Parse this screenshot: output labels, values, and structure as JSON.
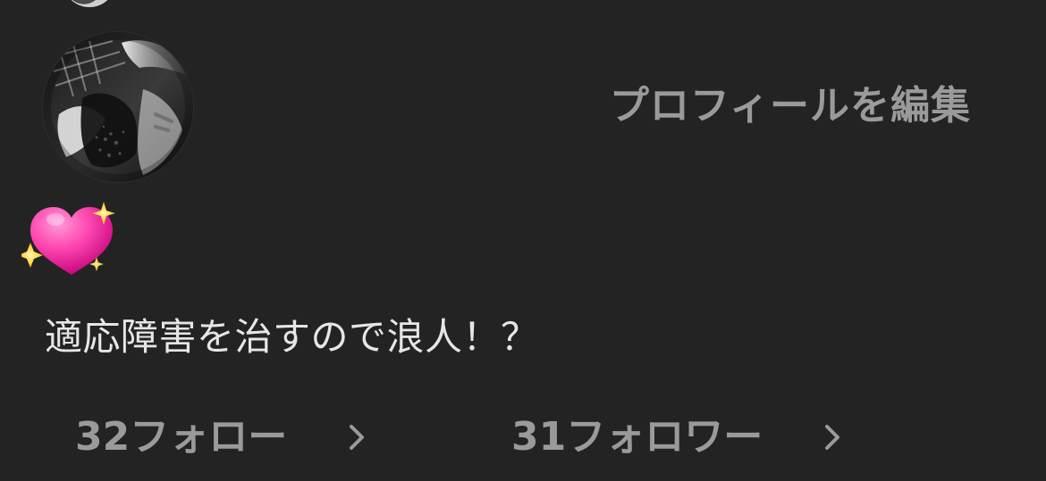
{
  "profile": {
    "edit_label": "プロフィールを編集",
    "avatar": {
      "label": ""
    },
    "bio_emoji": "💖",
    "bio_text": "適応障害を治すので浪人！？",
    "stats": {
      "following": {
        "count": "32",
        "label": "フォロー",
        "icon": "chevron-right-icon"
      },
      "followers": {
        "count": "31",
        "label": "フォロワー",
        "icon": "chevron-right-icon"
      }
    }
  },
  "colors": {
    "background": "#232323",
    "primary_text": "#e6e6e6",
    "secondary_text": "#9a9a9a",
    "accent_emoji_pink": "#ff3fa5",
    "accent_sparkle_yellow": "#ffd43b"
  }
}
